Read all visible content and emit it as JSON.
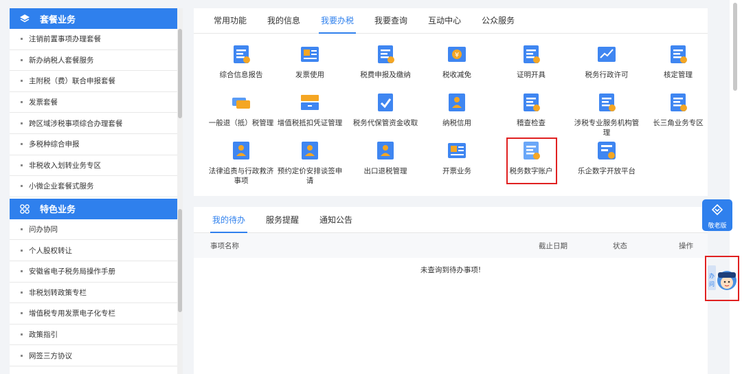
{
  "sidebar": {
    "section1": {
      "title": "套餐业务",
      "items": [
        "注销前置事项办理套餐",
        "新办纳税人套餐服务",
        "主附税（费）联合申报套餐",
        "发票套餐",
        "跨区域涉税事项综合办理套餐",
        "多税种综合申报",
        "非税收入划转业务专区",
        "小微企业套餐式服务"
      ]
    },
    "section2": {
      "title": "特色业务",
      "items": [
        "问办协同",
        "个人股权转让",
        "安徽省电子税务局操作手册",
        "非税划转政策专栏",
        "增值税专用发票电子化专栏",
        "政策指引",
        "网签三方协议"
      ]
    }
  },
  "top_tabs": [
    "常用功能",
    "我的信息",
    "我要办税",
    "我要查询",
    "互动中心",
    "公众服务"
  ],
  "top_tabs_active": 2,
  "services": [
    {
      "label": "综合信息报告",
      "icon": "report-icon"
    },
    {
      "label": "发票使用",
      "icon": "invoice-icon"
    },
    {
      "label": "税费申报及缴纳",
      "icon": "tax-declare-icon"
    },
    {
      "label": "税收减免",
      "icon": "tax-relief-icon"
    },
    {
      "label": "证明开具",
      "icon": "certificate-icon"
    },
    {
      "label": "税务行政许可",
      "icon": "license-chart-icon"
    },
    {
      "label": "核定管理",
      "icon": "verify-manage-icon"
    },
    {
      "label": "一般退（抵）税管理",
      "icon": "refund-icon"
    },
    {
      "label": "增值税抵扣凭证管理",
      "icon": "drawer-icon"
    },
    {
      "label": "税务代保管资金收取",
      "icon": "custody-icon"
    },
    {
      "label": "纳税信用",
      "icon": "credit-icon"
    },
    {
      "label": "稽查检查",
      "icon": "inspection-icon"
    },
    {
      "label": "涉税专业服务机构管理",
      "icon": "agency-icon"
    },
    {
      "label": "长三角业务专区",
      "icon": "yangtze-icon"
    },
    {
      "label": "法律追责与行政救济事项",
      "icon": "legal-icon"
    },
    {
      "label": "预约定价安排谈签申请",
      "icon": "pricing-icon"
    },
    {
      "label": "出口退税管理",
      "icon": "export-refund-icon"
    },
    {
      "label": "开票业务",
      "icon": "billing-icon"
    },
    {
      "label": "税务数字账户",
      "icon": "digital-account-icon"
    },
    {
      "label": "乐企数字开放平台",
      "icon": "open-platform-icon"
    }
  ],
  "bottom_tabs": [
    "我的待办",
    "服务提醒",
    "通知公告"
  ],
  "bottom_tabs_active": 0,
  "table": {
    "columns": [
      "事项名称",
      "截止日期",
      "状态",
      "操作"
    ],
    "empty_text": "未查询到待办事项!"
  },
  "elder_mode": "敬老版",
  "assistant_label": "办问"
}
